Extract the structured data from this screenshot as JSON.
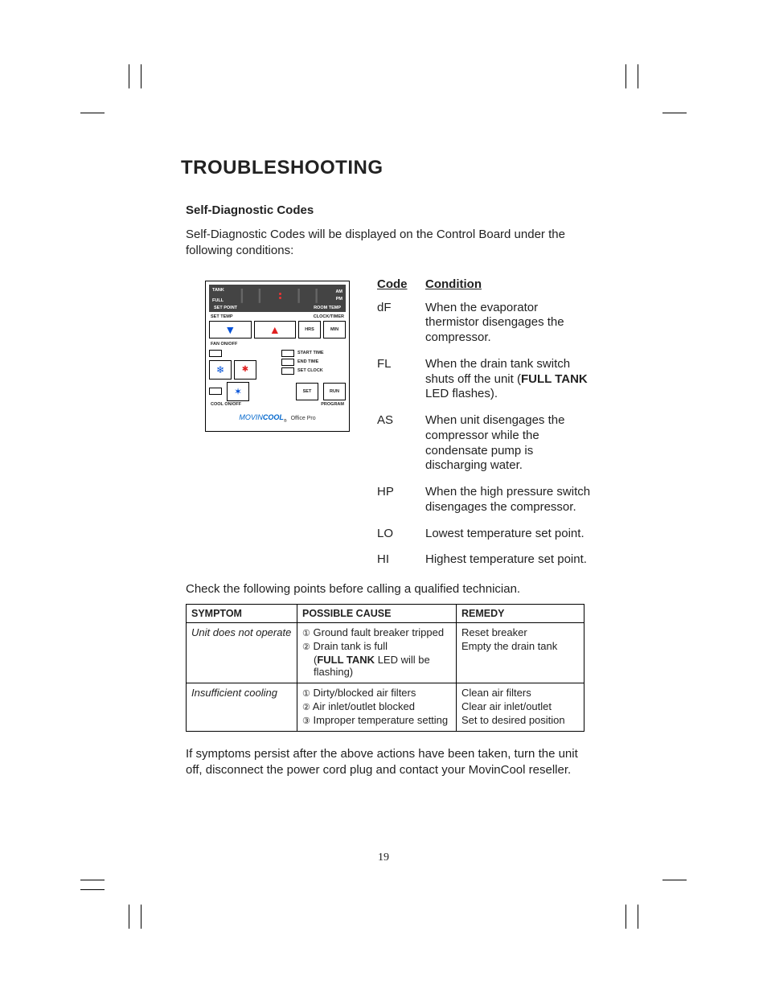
{
  "title": "TROUBLESHOOTING",
  "subtitle": "Self-Diagnostic Codes",
  "intro": "Self-Diagnostic Codes will be displayed on the Control Board under the following conditions:",
  "panel": {
    "tank": "TANK",
    "full": "FULL",
    "am": "AM",
    "pm": "PM",
    "set_point": "SET POINT",
    "room_temp": "ROOM TEMP",
    "set_temp": "SET TEMP",
    "clock_timer": "CLOCK/TIMER",
    "hrs": "HRS",
    "min": "MIN",
    "fan_onoff": "FAN ON/OFF",
    "start_time": "START TIME",
    "end_time": "END TIME",
    "set_clock": "SET CLOCK",
    "set": "SET",
    "run": "RUN",
    "cool_onoff": "COOL ON/OFF",
    "program": "PROGRAM",
    "brand_a": "MOVIN",
    "brand_b": "COOL",
    "brand_sub": "Office Pro",
    "reg": "®"
  },
  "codes_header": {
    "code": "Code",
    "condition": "Condition"
  },
  "codes": [
    {
      "code": "dF",
      "text": "When the evaporator thermistor disengages the compressor."
    },
    {
      "code": "FL",
      "pre": "When the drain tank switch shuts off the unit (",
      "bold": "FULL TANK",
      "post": " LED flashes)."
    },
    {
      "code": "AS",
      "text": "When unit disengages the compressor while the condensate pump is discharging water."
    },
    {
      "code": "HP",
      "text": "When the high pressure switch disengages the compressor."
    },
    {
      "code": "LO",
      "text": "Lowest temperature set point."
    },
    {
      "code": "HI",
      "text": "Highest temperature set point."
    }
  ],
  "check": "Check the following points before calling a qualified technician.",
  "table": {
    "head": {
      "symptom": "SYMPTOM",
      "cause": "POSSIBLE CAUSE",
      "remedy": "REMEDY"
    },
    "rows": [
      {
        "symptom": "Unit does not operate",
        "cause1": "Ground fault breaker tripped",
        "cause2a": "Drain tank is full",
        "cause2b_pre": "(",
        "cause2b_bold": "FULL TANK",
        "cause2b_post": " LED will be flashing)",
        "remedy1": "Reset breaker",
        "remedy2": "Empty the drain tank"
      },
      {
        "symptom": "Insufficient cooling",
        "cause1": "Dirty/blocked air filters",
        "cause2": "Air inlet/outlet blocked",
        "cause3": "Improper temperature setting",
        "remedy1": "Clean air filters",
        "remedy2": "Clear air inlet/outlet",
        "remedy3": "Set to desired position"
      }
    ]
  },
  "persist": "If symptoms persist after the above actions have been taken, turn the unit off, disconnect the power cord plug and contact your MovinCool reseller.",
  "page_num": "19"
}
